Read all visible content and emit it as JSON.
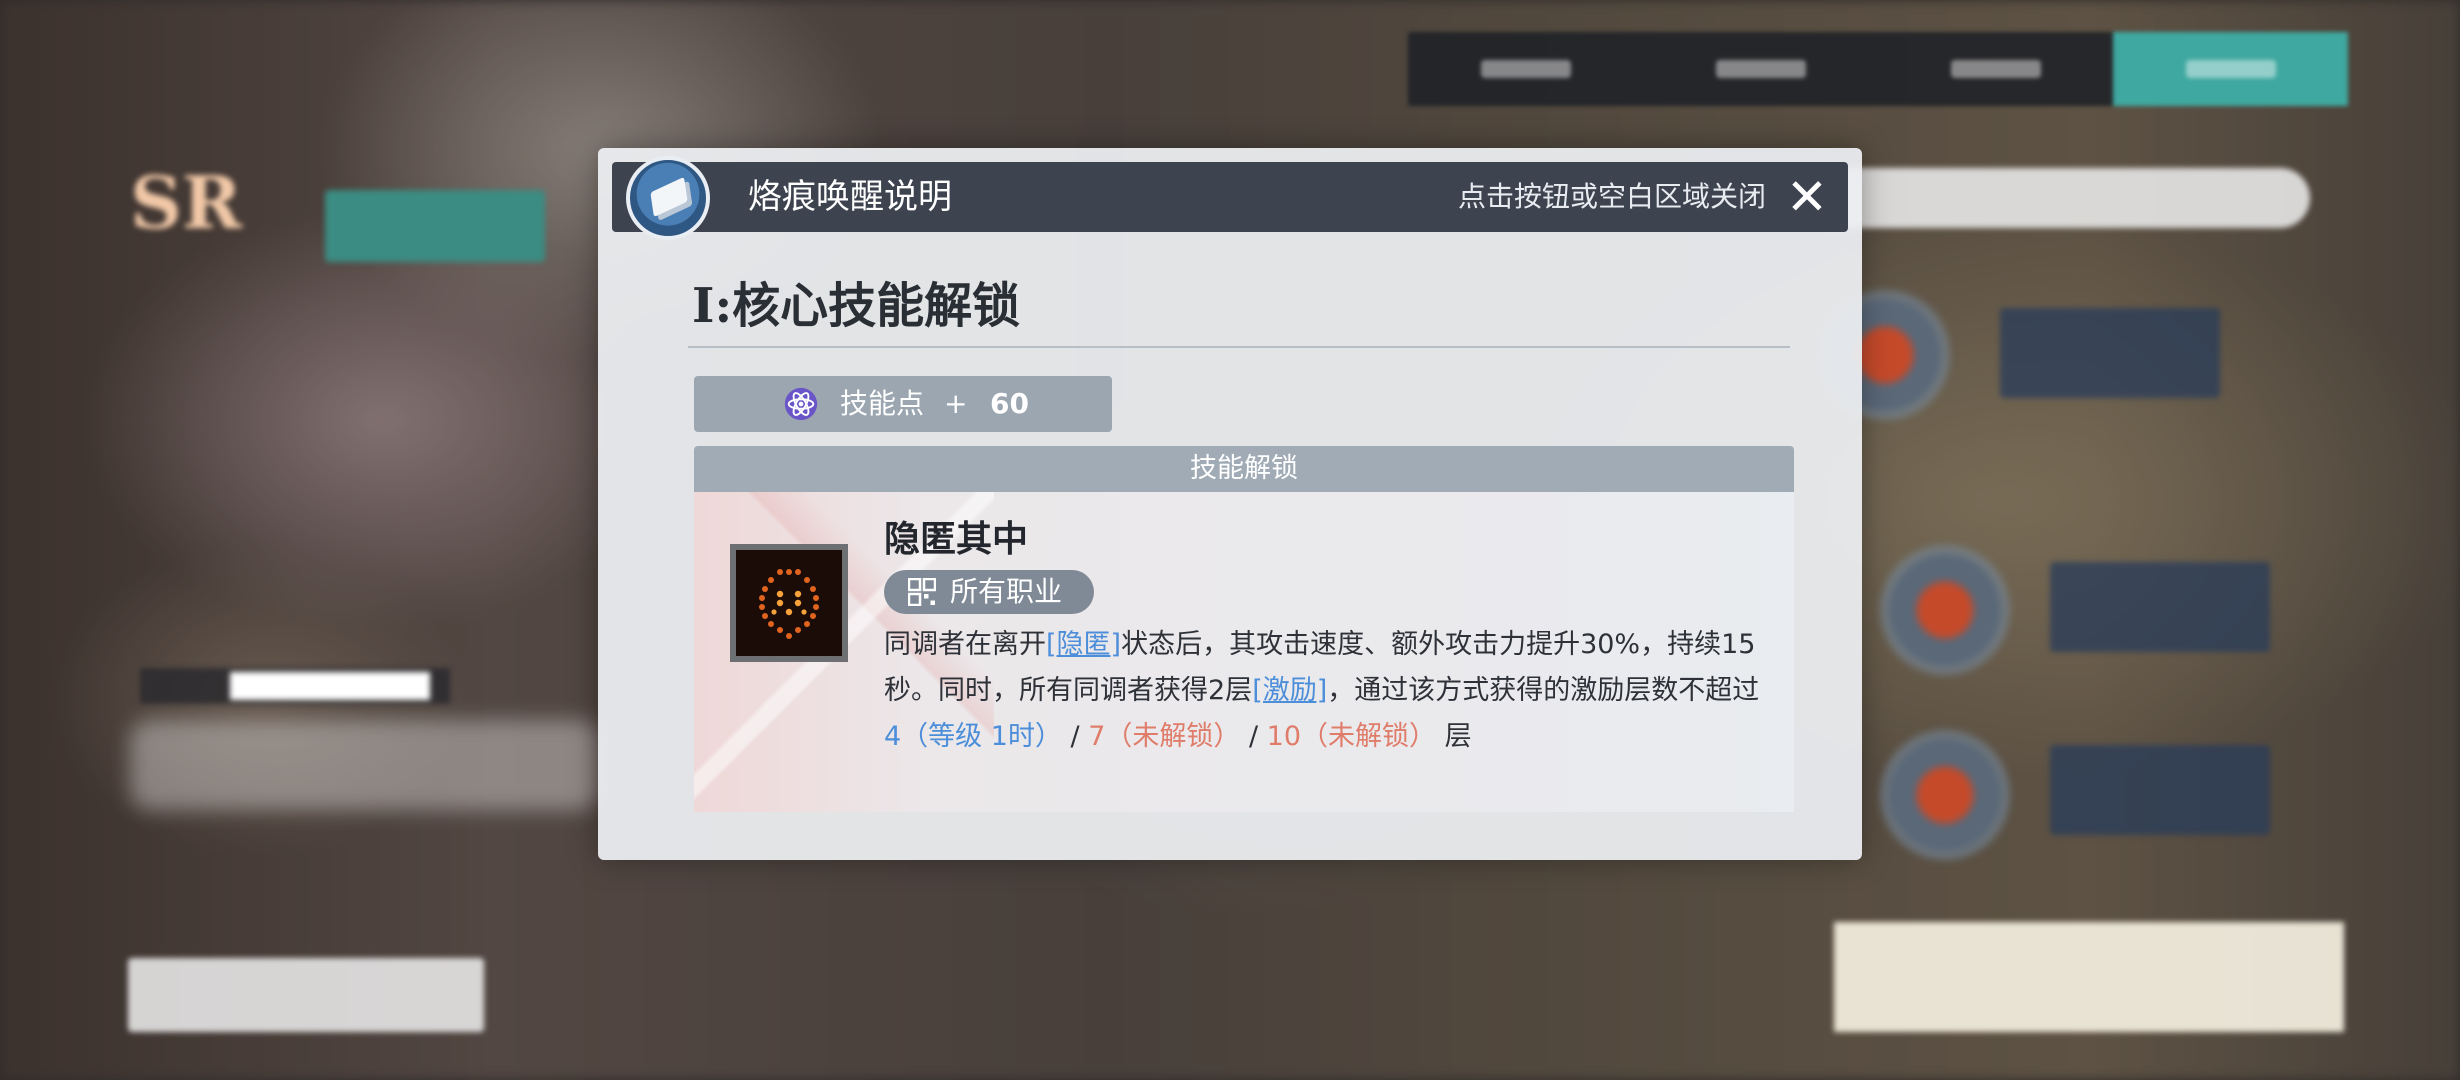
{
  "modal": {
    "title": "烙痕唤醒说明",
    "close_hint": "点击按钮或空白区域关闭",
    "close_glyph": "✕",
    "section_title": "I:核心技能解锁",
    "skill_points": {
      "label": "技能点",
      "plus": "+",
      "value": "60"
    },
    "unlock_header": "技能解锁",
    "skill": {
      "name": "隐匿其中",
      "job_tag": "所有职业",
      "desc": {
        "p1": "同调者在离开",
        "kw1": "[隐匿]",
        "p2": "状态后，其攻击速度、额外攻击力提升30%，持续15秒。同时，所有同调者获得2层",
        "kw2": "[激励]",
        "p3": "，通过该方式获得的激励层数不超过 ",
        "lv1": "4（等级 1时）",
        "sep1": " / ",
        "lv2": "7（未解锁）",
        "sep2": " / ",
        "lv3": "10（未解锁）",
        "p4": " 层"
      }
    }
  },
  "background": {
    "sr_badge": "SR"
  },
  "icons": {
    "modal_icon": "imprint-icon",
    "atom": "atom-icon",
    "job": "grid-icon",
    "skill": "lantern-skill-icon"
  },
  "colors": {
    "header_bg": "#3d4450",
    "keyword": "#4c8ed9",
    "locked": "#e07c6a",
    "accent_tab": "#3fa8a0"
  }
}
